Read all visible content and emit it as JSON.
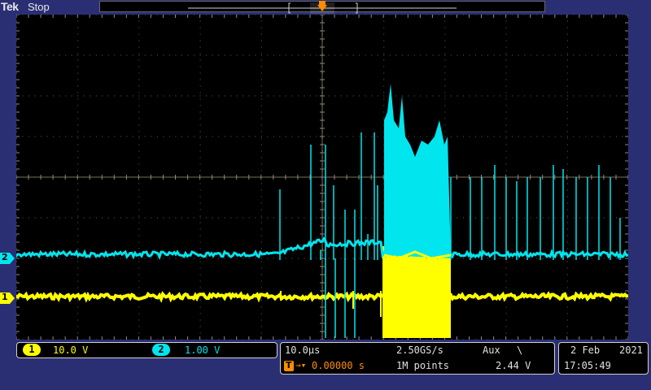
{
  "header": {
    "brand": "Tek",
    "status": "Stop"
  },
  "trigger": {
    "marker": "T"
  },
  "channels": [
    {
      "id": "1",
      "marker": "1",
      "scale": "10.0 V",
      "color": "#ffff00"
    },
    {
      "id": "2",
      "marker": "2",
      "scale": "1.00 V",
      "color": "#00e5ee"
    }
  ],
  "horizontal": {
    "timebase": "10.0µs",
    "sample_rate": "2.50GS/s",
    "record_length": "1M points",
    "position_prefix": "T",
    "position": "0.00000 s"
  },
  "trigger_info": {
    "source": "Aux",
    "slope_symbol": "\\",
    "level": "2.44 V"
  },
  "datetime": {
    "date_day_month": "2 Feb",
    "year": "2021",
    "time": "17:05:49"
  },
  "colors": {
    "trigger_orange": "#ff8c00",
    "grid": "#8a8a8a",
    "panel_border": "#d0d0d0"
  }
}
